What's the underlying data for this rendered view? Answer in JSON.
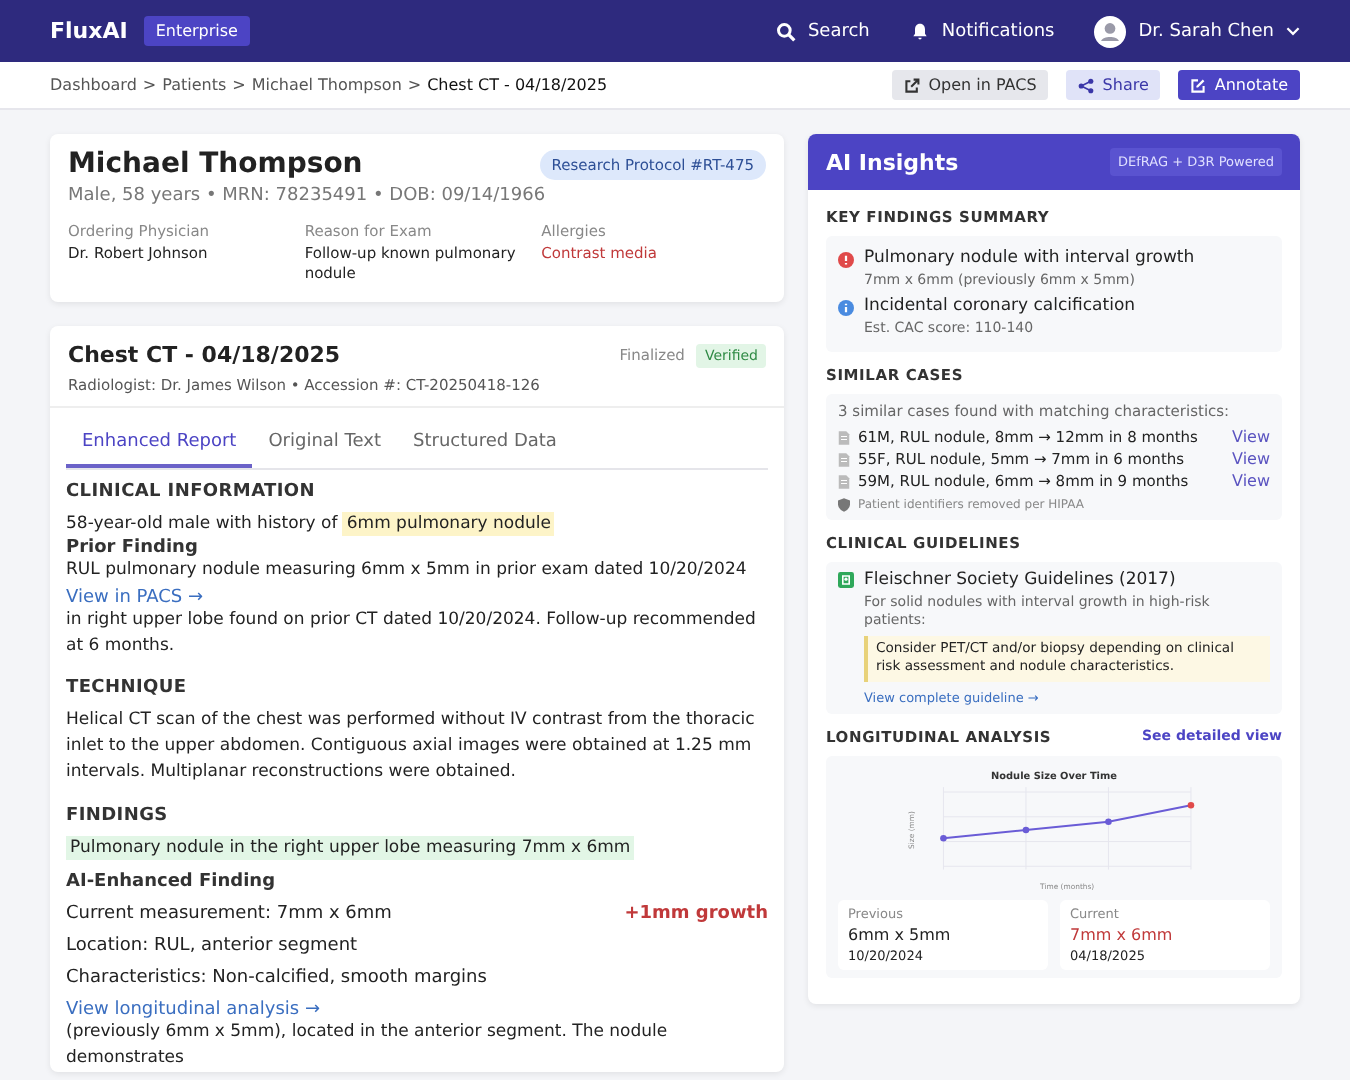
{
  "header": {
    "brand": "FluxAI",
    "edition": "Enterprise",
    "search": "Search",
    "notifications": "Notifications",
    "user": "Dr. Sarah Chen"
  },
  "breadcrumb": {
    "items": [
      {
        "label": "Dashboard",
        "current": false
      },
      {
        "label": "Patients",
        "current": false
      },
      {
        "label": "Michael Thompson",
        "current": false
      },
      {
        "label": "Chest CT - 04/18/2025",
        "current": true
      }
    ],
    "separator": ">",
    "actions": [
      {
        "label": "Open in PACS",
        "kind": "secondary"
      },
      {
        "label": "Share",
        "kind": "share"
      },
      {
        "label": "Annotate",
        "kind": "primary"
      }
    ]
  },
  "patient": {
    "name": "Michael Thompson",
    "protocol": "Research Protocol #RT-475",
    "demographics": "Male, 58 years • MRN: 78235491 • DOB: 09/14/1966",
    "fields": [
      {
        "label": "Ordering Physician",
        "value": "Dr. Robert Johnson",
        "alert": false
      },
      {
        "label": "Reason for Exam",
        "value": "Follow-up known pulmonary nodule",
        "alert": false
      },
      {
        "label": "Allergies",
        "value": "Contrast media",
        "alert": true
      }
    ]
  },
  "exam": {
    "title": "Chest CT - 04/18/2025",
    "meta": "Radiologist: Dr. James Wilson • Accession #: CT-20250418-126",
    "status": "Finalized",
    "verified": "Verified",
    "tabs": [
      {
        "label": "Enhanced Report",
        "selected": true
      },
      {
        "label": "Original Text",
        "selected": false
      },
      {
        "label": "Structured Data",
        "selected": false
      }
    ]
  },
  "report": {
    "clinical": {
      "heading": "CLINICAL INFORMATION",
      "lead": "58-year-old male with history of",
      "highlight": "6mm pulmonary nodule",
      "prior_title": "Prior Finding",
      "prior_text": "RUL pulmonary nodule measuring 6mm x 5mm in prior exam dated 10/20/2024",
      "prior_link": "View in PACS →",
      "rest": "in right upper lobe found on prior CT dated 10/20/2024. Follow-up recommended at 6 months."
    },
    "technique": {
      "heading": "TECHNIQUE",
      "text": "Helical CT scan of the chest was performed without IV contrast from the thoracic inlet to the upper abdomen. Contiguous axial images were obtained at 1.25 mm intervals. Multiplanar reconstructions were obtained."
    },
    "findings": {
      "heading": "FINDINGS",
      "highlight": "Pulmonary nodule in the right upper lobe measuring 7mm x 6mm",
      "ai_title": "AI-Enhanced Finding",
      "rows": [
        {
          "text": "Current measurement: 7mm x 6mm",
          "flag": "+1mm growth"
        },
        {
          "text": "Location: RUL, anterior segment"
        },
        {
          "text": "Characteristics: Non-calcified, smooth margins"
        }
      ],
      "link": "View longitudinal analysis →",
      "rest": "(previously 6mm x 5mm), located in the anterior segment. The nodule demonstrates"
    }
  },
  "insights": {
    "title": "AI Insights",
    "badge": "DEfRAG + D3R Powered",
    "key": {
      "heading": "KEY FINDINGS SUMMARY",
      "items": [
        {
          "kind": "alert",
          "title": "Pulmonary nodule with interval growth",
          "detail": "7mm x 6mm (previously 6mm x 5mm)"
        },
        {
          "kind": "info",
          "title": "Incidental coronary calcification",
          "detail": "Est. CAC score: 110-140"
        }
      ]
    },
    "similar": {
      "heading": "SIMILAR CASES",
      "intro": "3 similar cases found with matching characteristics:",
      "cases": [
        {
          "text": "61M, RUL nodule, 8mm → 12mm in 8 months",
          "link": "View"
        },
        {
          "text": "55F, RUL nodule, 5mm → 7mm in 6 months",
          "link": "View"
        },
        {
          "text": "59M, RUL nodule, 6mm → 8mm in 9 months",
          "link": "View"
        }
      ],
      "note": "Patient identifiers removed per HIPAA"
    },
    "guidelines": {
      "heading": "CLINICAL GUIDELINES",
      "title": "Fleischner Society Guidelines (2017)",
      "text": "For solid nodules with interval growth in high-risk patients:",
      "recommendation": "Consider PET/CT and/or biopsy depending on clinical risk assessment and nodule characteristics.",
      "link": "View complete guideline →"
    },
    "longitudinal": {
      "heading": "LONGITUDINAL ANALYSIS",
      "link": "See detailed view",
      "chart_title": "Nodule Size Over Time",
      "ylabel": "Size (mm)",
      "xlabel": "Time (months)",
      "compare": [
        {
          "label": "Previous",
          "value": "6mm x 5mm",
          "date": "10/20/2024",
          "current": false
        },
        {
          "label": "Current",
          "value": "7mm x 6mm",
          "date": "04/18/2025",
          "current": true
        }
      ]
    }
  }
}
